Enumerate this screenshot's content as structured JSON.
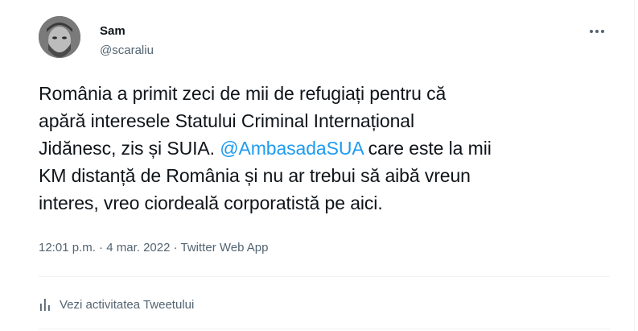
{
  "author": {
    "name": "Sam",
    "handle": "@scaraliu"
  },
  "tweet": {
    "text_part1": "România a primit zeci de mii de refugiați pentru că\napără interesele Statului Criminal Internațional\nJidănesc, zis și SUIA. ",
    "mention": "@AmbasadaSUA",
    "text_part2": " care este la mii\nKM distanță de România și nu ar trebui să aibă vreun\ninteres, vreo ciordeală corporatistă pe aici."
  },
  "meta": {
    "time": "12:01 p.m.",
    "separator1": " · ",
    "date": "4 mar. 2022",
    "separator2": " · ",
    "app": "Twitter Web App"
  },
  "activity": {
    "label": "Vezi activitatea Tweetului"
  },
  "icons": {
    "more": "more-horizontal-icon",
    "activity": "bar-chart-icon"
  }
}
